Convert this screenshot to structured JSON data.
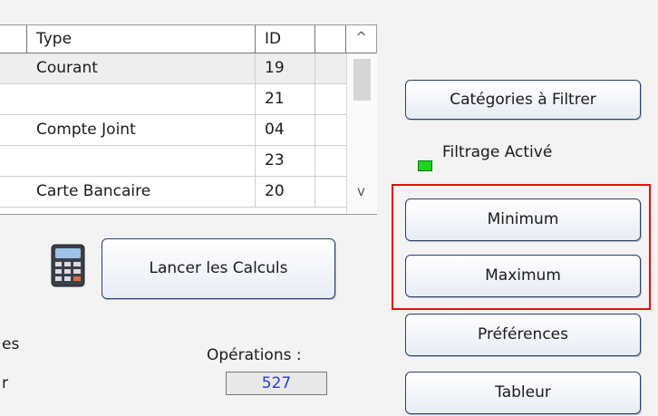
{
  "grid": {
    "columns": [
      "Type",
      "ID"
    ],
    "rows": [
      {
        "type": "Courant",
        "id": "19",
        "selected": true
      },
      {
        "type": "",
        "id": "21",
        "selected": false
      },
      {
        "type": "Compte Joint",
        "id": "04",
        "selected": false
      },
      {
        "type": "",
        "id": "23",
        "selected": false
      },
      {
        "type": "Carte Bancaire",
        "id": "20",
        "selected": false
      }
    ]
  },
  "buttons": {
    "categories": "Catégories à Filtrer",
    "minimum": "Minimum",
    "maximum": "Maximum",
    "preferences": "Préférences",
    "tableur": "Tableur",
    "calculs": "Lancer les Calculs"
  },
  "filter": {
    "label": "Filtrage Activé",
    "led_color": "#1ed41e"
  },
  "left_fragments": {
    "line1": "es",
    "line2": "r"
  },
  "operations": {
    "label": "Opérations :",
    "value": "527"
  },
  "icons": {
    "calculator": "calculator-icon",
    "up": "scroll-up-arrow",
    "down": "scroll-down-arrow"
  }
}
